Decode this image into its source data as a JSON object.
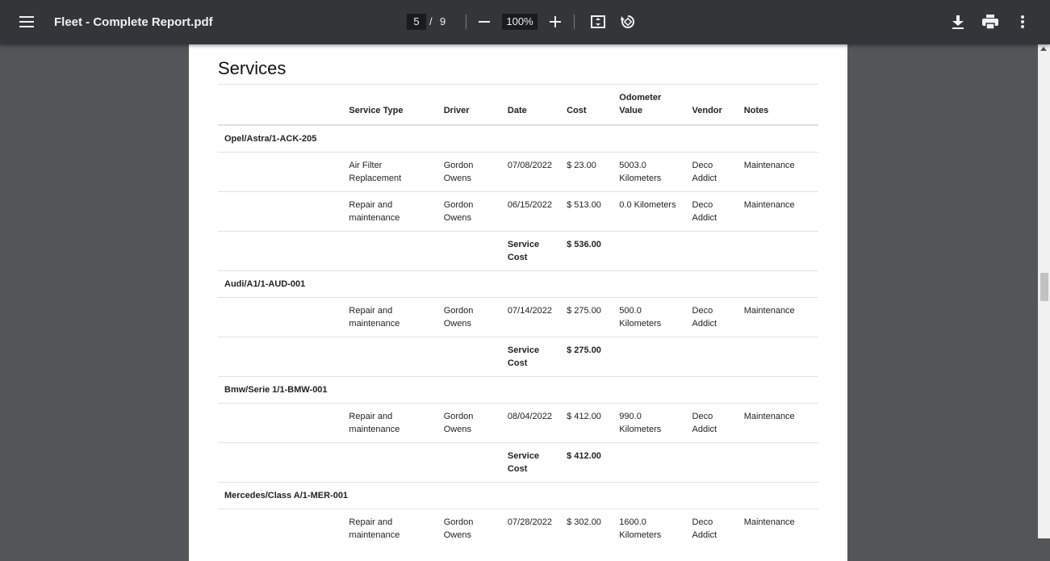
{
  "toolbar": {
    "title": "Fleet - Complete Report.pdf",
    "current_page": "5",
    "page_separator": "/",
    "total_pages": "9",
    "zoom": "100%"
  },
  "report": {
    "section_title": "Services",
    "headers": {
      "vehicle": "",
      "service_type": "Service Type",
      "driver": "Driver",
      "date": "Date",
      "cost": "Cost",
      "odometer": "Odometer Value",
      "vendor": "Vendor",
      "notes": "Notes"
    },
    "rows": [
      {
        "kind": "group",
        "vehicle": "Opel/Astra/1-ACK-205"
      },
      {
        "kind": "item",
        "service_type": "Air Filter Replacement",
        "driver": "Gordon Owens",
        "date": "07/08/2022",
        "cost": "$ 23.00",
        "odometer": "5003.0 Kilometers",
        "vendor": "Deco Addict",
        "notes": "Maintenance"
      },
      {
        "kind": "item",
        "service_type": "Repair and maintenance",
        "driver": "Gordon Owens",
        "date": "06/15/2022",
        "cost": "$ 513.00",
        "odometer": "0.0 Kilometers",
        "vendor": "Deco Addict",
        "notes": "Maintenance"
      },
      {
        "kind": "total",
        "label": "Service Cost",
        "cost": "$ 536.00"
      },
      {
        "kind": "group",
        "vehicle": "Audi/A1/1-AUD-001"
      },
      {
        "kind": "item",
        "service_type": "Repair and maintenance",
        "driver": "Gordon Owens",
        "date": "07/14/2022",
        "cost": "$ 275.00",
        "odometer": "500.0 Kilometers",
        "vendor": "Deco Addict",
        "notes": "Maintenance"
      },
      {
        "kind": "total",
        "label": "Service Cost",
        "cost": "$ 275.00"
      },
      {
        "kind": "group",
        "vehicle": "Bmw/Serie 1/1-BMW-001"
      },
      {
        "kind": "item",
        "service_type": "Repair and maintenance",
        "driver": "Gordon Owens",
        "date": "08/04/2022",
        "cost": "$ 412.00",
        "odometer": "990.0 Kilometers",
        "vendor": "Deco Addict",
        "notes": "Maintenance"
      },
      {
        "kind": "total",
        "label": "Service Cost",
        "cost": "$ 412.00"
      },
      {
        "kind": "group",
        "vehicle": "Mercedes/Class A/1-MER-001"
      },
      {
        "kind": "item",
        "service_type": "Repair and maintenance",
        "driver": "Gordon Owens",
        "date": "07/28/2022",
        "cost": "$ 302.00",
        "odometer": "1600.0 Kilometers",
        "vendor": "Deco Addict",
        "notes": "Maintenance"
      }
    ]
  }
}
